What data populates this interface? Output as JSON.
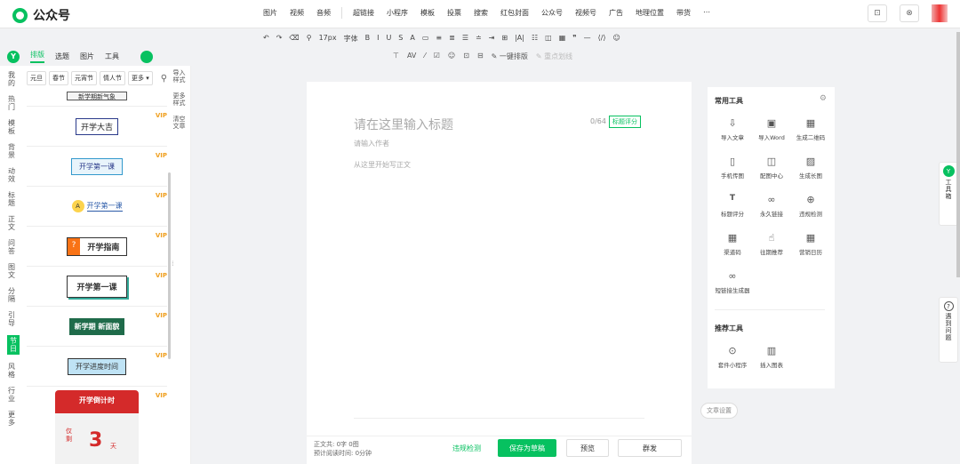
{
  "app": {
    "title": "公众号"
  },
  "menu": [
    "图片",
    "视频",
    "音频",
    "超链接",
    "小程序",
    "模板",
    "投票",
    "搜索",
    "红包封面",
    "公众号",
    "视频号",
    "广告",
    "地理位置",
    "带货",
    "⋯"
  ],
  "toolbar1": [
    "↶",
    "↷",
    "⌫",
    "⚲",
    "17px",
    "字体",
    "B",
    "I",
    "U",
    "S",
    "A",
    "▭",
    "≡",
    "≣",
    "☰",
    "≐",
    "⇥",
    "⊞",
    "|A|",
    "☷",
    "◫",
    "▦",
    "❞",
    "—",
    "⟨/⟩",
    "☺"
  ],
  "toolbar2": [
    "⊤",
    "AV",
    "⁄",
    "☑",
    "☺",
    "⊡",
    "⊟",
    "✎ 一键排版",
    "✎ 重点划线"
  ],
  "sidetabs": {
    "badge": "Y",
    "tab1": "排版",
    "tab2": "选题",
    "tab3": "图片",
    "tab4": "工具"
  },
  "left_nav": [
    "我的",
    "热门",
    "模板",
    "背景",
    "动效",
    "标题",
    "正文",
    "问答",
    "图文",
    "分隔",
    "引导",
    "节日",
    "风格",
    "行业",
    "更多"
  ],
  "filters": [
    "元旦",
    "春节",
    "元宵节",
    "情人节",
    "更多 ▾"
  ],
  "items": [
    {
      "text": "新学期新气象"
    },
    {
      "text": "开学大吉"
    },
    {
      "text": "开学第一课"
    },
    {
      "text": "开学第一课"
    },
    {
      "text": "开学指南"
    },
    {
      "text": "开学第一课"
    },
    {
      "text": "新学期 新面貌"
    },
    {
      "text": "开学进度时间"
    },
    {
      "text": "开学倒计时",
      "extra": "仅剩",
      "num": "3",
      "unit": "天"
    }
  ],
  "vip_label": "VIP",
  "side_tools": [
    {
      "label": "导入样式"
    },
    {
      "label": "更多样式"
    },
    {
      "label": "清空文章"
    }
  ],
  "editor": {
    "title_ph": "请在这里输入标题",
    "count": "0/64",
    "score": "标题评分",
    "author_ph": "请输入作者",
    "body_ph": "从这里开始写正文"
  },
  "bottom": {
    "stats1": "正文共: 0字 0图",
    "stats2": "预计阅读时间: 0分钟",
    "check": "违规检测",
    "save": "保存为草稿",
    "preview": "预览",
    "publish": "群发"
  },
  "rpanel": {
    "title": "常用工具",
    "tools": [
      {
        "icon": "⇩",
        "label": "导入文章"
      },
      {
        "icon": "▣",
        "label": "导入Word"
      },
      {
        "icon": "▦",
        "label": "生成二维码"
      },
      {
        "icon": "▯",
        "label": "手机传图"
      },
      {
        "icon": "◫",
        "label": "配图中心"
      },
      {
        "icon": "▨",
        "label": "生成长图"
      },
      {
        "icon": "T",
        "label": "标题评分"
      },
      {
        "icon": "∞",
        "label": "永久链接"
      },
      {
        "icon": "⊕",
        "label": "违规检测"
      },
      {
        "icon": "▦",
        "label": "渠道码"
      },
      {
        "icon": "☝",
        "label": "往期推荐"
      },
      {
        "icon": "▦",
        "label": "营销日历"
      },
      {
        "icon": "∞",
        "label": "短链接生成器"
      }
    ],
    "title2": "推荐工具",
    "tools2": [
      {
        "icon": "⊙",
        "label": "套件小程序"
      },
      {
        "icon": "▥",
        "label": "插入图表"
      }
    ]
  },
  "article_settings": "文章设置",
  "float1": {
    "badge": "Y",
    "text": "工具箱"
  },
  "float2": {
    "text": "遇到问题"
  },
  "top_right": {
    "b1": "⊡",
    "b2": "⊗"
  }
}
